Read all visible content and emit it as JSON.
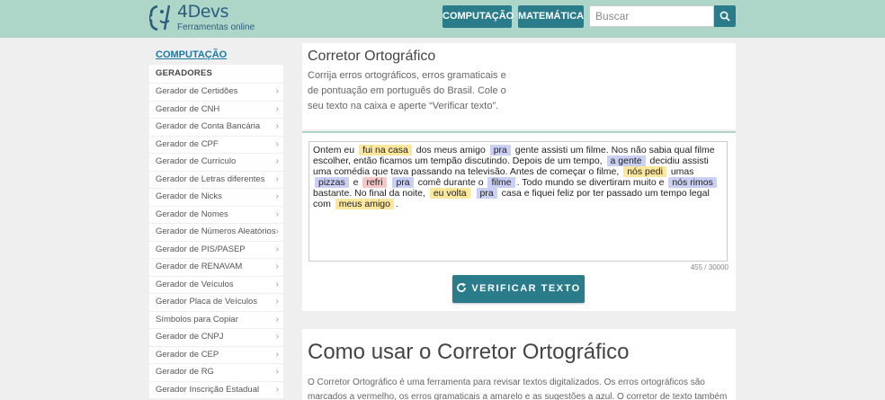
{
  "header": {
    "logo_name": "4Devs",
    "logo_sub": "Ferramentas online",
    "nav": [
      {
        "label": "COMPUTAÇÃO"
      },
      {
        "label": "MATEMÁTICA"
      }
    ],
    "search": {
      "placeholder": "Buscar",
      "value": ""
    },
    "colors": {
      "header_bg": "#aed6c8",
      "accent": "#2a7c8a"
    }
  },
  "sidebar": {
    "section": "COMPUTAÇÃO",
    "group": "GERADORES",
    "items": [
      {
        "label": "Gerador de Certidões"
      },
      {
        "label": "Gerador de CNH"
      },
      {
        "label": "Gerador de Conta Bancária"
      },
      {
        "label": "Gerador de CPF"
      },
      {
        "label": "Gerador de Currículo"
      },
      {
        "label": "Gerador de Letras diferentes"
      },
      {
        "label": "Gerador de Nicks"
      },
      {
        "label": "Gerador de Nomes"
      },
      {
        "label": "Gerador de Números Aleatórios"
      },
      {
        "label": "Gerador de PIS/PASEP"
      },
      {
        "label": "Gerador de RENAVAM"
      },
      {
        "label": "Gerador de Veículos"
      },
      {
        "label": "Gerador Placa de Veículos"
      },
      {
        "label": "Símbolos para Copiar"
      },
      {
        "label": "Gerador de CNPJ"
      },
      {
        "label": "Gerador de CEP"
      },
      {
        "label": "Gerador de RG"
      },
      {
        "label": "Gerador Inscrição Estadual"
      }
    ]
  },
  "main": {
    "title": "Corretor Ortográfico",
    "description": "Corrija erros ortográficos, erros gramaticais e de pontuação em português do Brasil. Cole o seu texto na caixa e aperte “Verificar texto”.",
    "editor": {
      "segments": [
        {
          "text": "Ontem eu "
        },
        {
          "text": "fui na casa",
          "mark": "y"
        },
        {
          "text": " dos meus amigo "
        },
        {
          "text": "pra",
          "mark": "b"
        },
        {
          "text": " gente assisti um filme. Nos não sabia qual filme escolher, então ficamos um tempão discutindo. Depois de um tempo, "
        },
        {
          "text": "a gente",
          "mark": "b"
        },
        {
          "text": " decidiu assisti uma comédia que tava passando na televisão. Antes de começar o filme, "
        },
        {
          "text": "nós pedi",
          "mark": "y"
        },
        {
          "text": " umas "
        },
        {
          "text": "pizzas",
          "mark": "b"
        },
        {
          "text": " e "
        },
        {
          "text": "refri",
          "mark": "r"
        },
        {
          "text": " "
        },
        {
          "text": "pra",
          "mark": "b"
        },
        {
          "text": " comê durante o "
        },
        {
          "text": "filme",
          "mark": "b"
        },
        {
          "text": ". Todo mundo se divertiram muito e "
        },
        {
          "text": "nós rimos",
          "mark": "b"
        },
        {
          "text": " bastante. No final da noite, "
        },
        {
          "text": "eu volta",
          "mark": "y"
        },
        {
          "text": " "
        },
        {
          "text": "pra",
          "mark": "b"
        },
        {
          "text": " casa e fiquei feliz por ter passado um tempo legal com "
        },
        {
          "text": "meus amigo",
          "mark": "y"
        },
        {
          "text": "."
        }
      ],
      "mark_colors": {
        "grammar": "#fde79c",
        "suggestion": "#c9d0f4",
        "spelling": "#f8c6c6"
      }
    },
    "counter": "455 / 30000",
    "verify_button": "VERIFICAR TEXTO",
    "how_title": "Como usar o Corretor Ortográfico",
    "how_text": "O Corretor Ortográfico é uma ferramenta para revisar textos digitalizados. Os erros ortográficos são marcados a vermelho, os erros gramaticais a amarelo e as sugestões a azul. O corretor de texto também identifica erros"
  }
}
